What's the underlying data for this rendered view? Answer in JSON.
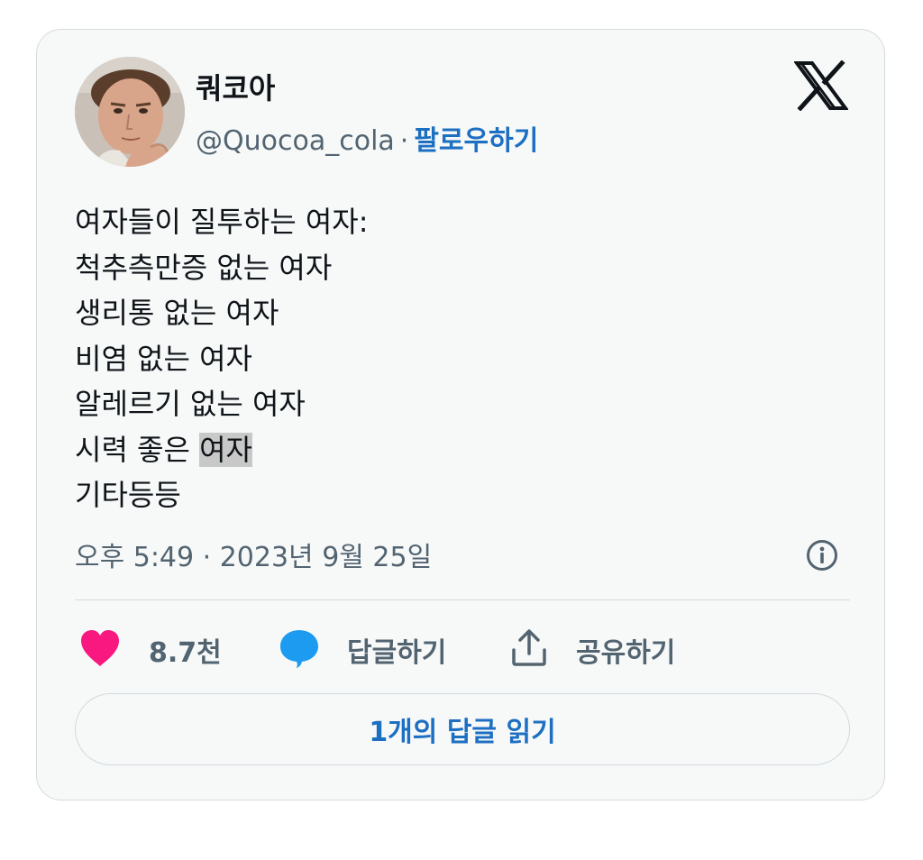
{
  "author": {
    "display_name": "쿼코아",
    "handle": "@Quocoa_cola",
    "separator": "·",
    "follow_label": "팔로우하기"
  },
  "tweet": {
    "lines": [
      "여자들이 질투하는 여자:",
      "척추측만증 없는 여자",
      "생리통 없는 여자",
      "비염 없는 여자",
      "알레르기 없는 여자",
      "시력 좋은 ",
      "기타등등"
    ],
    "highlighted_text": "여자",
    "timestamp": "오후 5:49 · 2023년 9월 25일"
  },
  "actions": {
    "like_count": "8.7천",
    "reply_label": "답글하기",
    "share_label": "공유하기"
  },
  "read_replies_label": "1개의 답글 읽기",
  "icons": {
    "brand": "x-logo-icon",
    "info": "info-icon",
    "like": "heart-icon",
    "reply": "speech-bubble-icon",
    "share": "share-upload-icon"
  },
  "colors": {
    "like": "#f91880",
    "reply": "#1d9bf0",
    "link": "#1d6fc2",
    "muted": "#536471",
    "text": "#0f1419"
  }
}
